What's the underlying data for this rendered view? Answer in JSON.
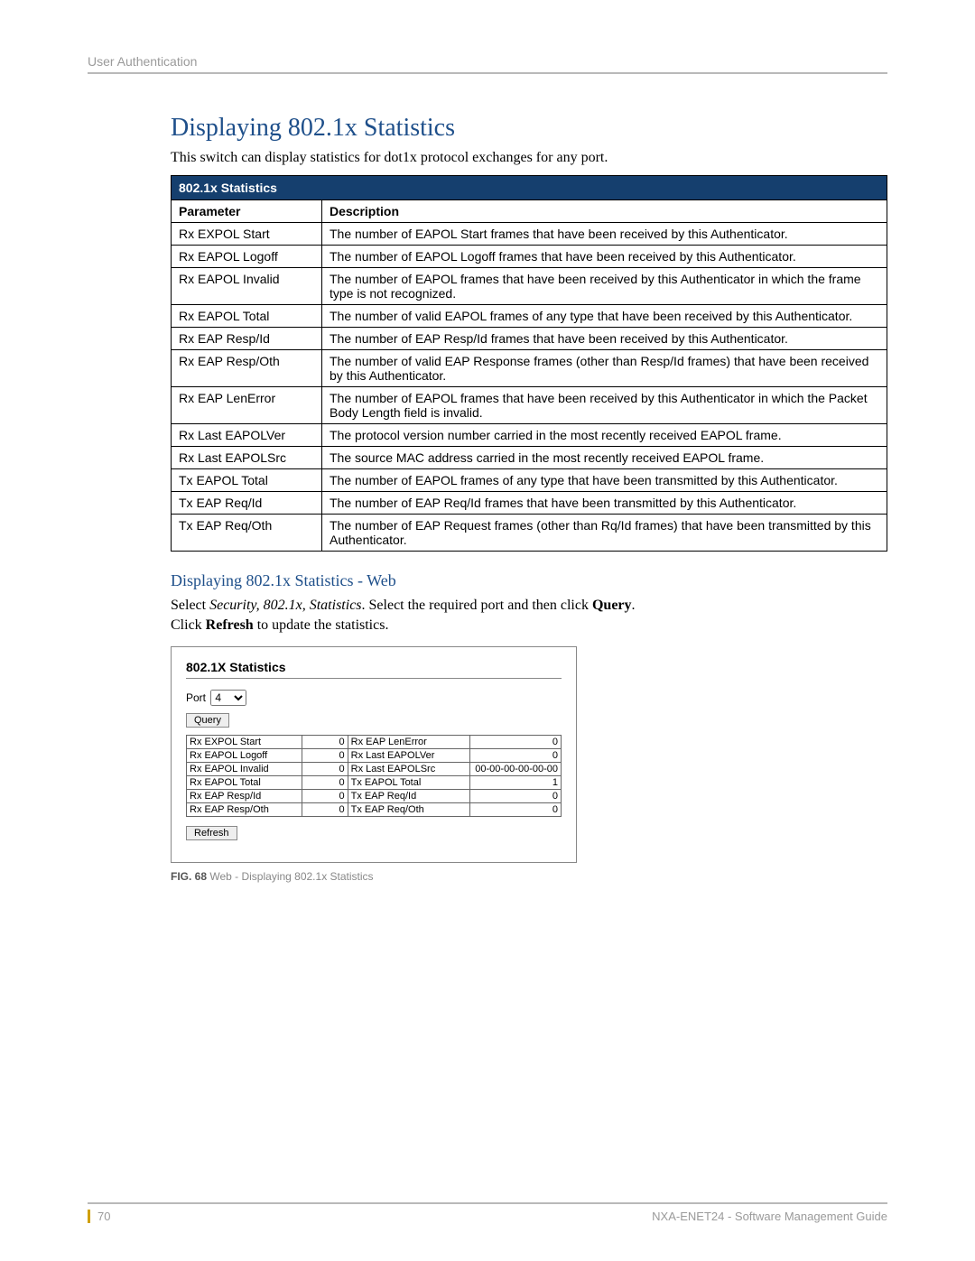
{
  "header": {
    "section": "User Authentication"
  },
  "main": {
    "title": "Displaying 802.1x Statistics",
    "intro": "This switch can display statistics for dot1x protocol exchanges for any port.",
    "table_title": "802.1x Statistics",
    "col_param": "Parameter",
    "col_desc": "Description",
    "rows": [
      {
        "p": "Rx EXPOL Start",
        "d": "The number of EAPOL Start frames that have been received by this Authenticator."
      },
      {
        "p": "Rx EAPOL Logoff",
        "d": "The number of EAPOL Logoff frames that have been received by this Authenticator."
      },
      {
        "p": "Rx EAPOL Invalid",
        "d": "The number of EAPOL frames that have been received by this Authenticator in which the frame type is not recognized."
      },
      {
        "p": "Rx EAPOL Total",
        "d": "The number of valid EAPOL frames of any type that have been received by this Authenticator."
      },
      {
        "p": "Rx EAP Resp/Id",
        "d": "The number of EAP Resp/Id frames that have been received by this Authenticator."
      },
      {
        "p": "Rx EAP Resp/Oth",
        "d": "The number of valid EAP Response frames (other than Resp/Id frames) that have been received by this Authenticator."
      },
      {
        "p": "Rx EAP LenError",
        "d": "The number of EAPOL frames that have been received by this Authenticator in which the Packet Body Length field is invalid."
      },
      {
        "p": "Rx Last EAPOLVer",
        "d": "The protocol version number carried in the most recently received EAPOL frame."
      },
      {
        "p": "Rx Last EAPOLSrc",
        "d": "The source MAC address carried in the most recently received EAPOL frame."
      },
      {
        "p": "Tx EAPOL Total",
        "d": "The number of EAPOL frames of any type that have been transmitted by this Authenticator."
      },
      {
        "p": "Tx EAP Req/Id",
        "d": "The number of EAP Req/Id frames that have been transmitted by this Authenticator."
      },
      {
        "p": "Tx EAP Req/Oth",
        "d": "The number of EAP Request frames (other than Rq/Id frames) that have been transmitted by this Authenticator."
      }
    ],
    "subhead": "Displaying 802.1x Statistics - Web",
    "step1_pre": "Select ",
    "step1_i": "Security, 802.1x, Statistics",
    "step1_mid": ". Select the required port and then click ",
    "step1_b": "Query",
    "step1_end": ".",
    "step2_pre": "Click ",
    "step2_b": "Refresh",
    "step2_end": " to update the statistics."
  },
  "figure": {
    "title": "802.1X Statistics",
    "port_label": "Port",
    "port_value": "4",
    "query": "Query",
    "refresh": "Refresh",
    "left": [
      {
        "n": "Rx EXPOL Start",
        "v": "0"
      },
      {
        "n": "Rx EAPOL Logoff",
        "v": "0"
      },
      {
        "n": "Rx EAPOL Invalid",
        "v": "0"
      },
      {
        "n": "Rx EAPOL Total",
        "v": "0"
      },
      {
        "n": "Rx EAP Resp/Id",
        "v": "0"
      },
      {
        "n": "Rx EAP Resp/Oth",
        "v": "0"
      }
    ],
    "right": [
      {
        "n": "Rx EAP LenError",
        "v": "0"
      },
      {
        "n": "Rx Last EAPOLVer",
        "v": "0"
      },
      {
        "n": "Rx Last EAPOLSrc",
        "v": "00-00-00-00-00-00"
      },
      {
        "n": "Tx EAPOL Total",
        "v": "1"
      },
      {
        "n": "Tx EAP Req/Id",
        "v": "0"
      },
      {
        "n": "Tx EAP Req/Oth",
        "v": "0"
      }
    ],
    "caption_b": "FIG. 68",
    "caption": "  Web - Displaying 802.1x Statistics"
  },
  "footer": {
    "page": "70",
    "doc": "NXA-ENET24 - Software Management Guide"
  }
}
